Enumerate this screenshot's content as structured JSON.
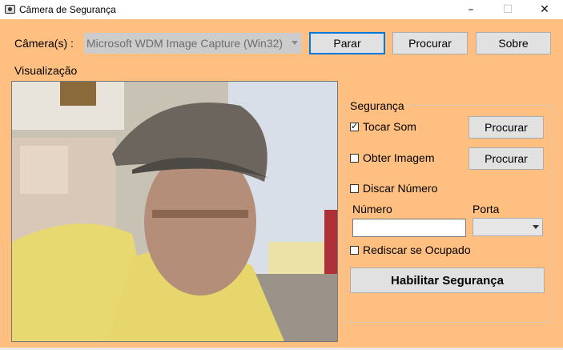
{
  "window": {
    "title": "Câmera de Segurança",
    "minimize_glyph": "–",
    "maximize_glyph": "☐",
    "close_glyph": "✕"
  },
  "camera": {
    "label": "Câmera(s) :",
    "selected": "Microsoft WDM Image Capture (Win32)"
  },
  "toolbar": {
    "stop_label": "Parar",
    "browse_label": "Procurar",
    "about_label": "Sobre"
  },
  "preview": {
    "label": "Visualização"
  },
  "security": {
    "group_label": "Segurança",
    "play_sound": {
      "label": "Tocar Som",
      "checked": true,
      "browse_label": "Procurar"
    },
    "get_image": {
      "label": "Obter Imagem",
      "checked": false,
      "browse_label": "Procurar"
    },
    "dial_number": {
      "label": "Discar Número",
      "checked": false
    },
    "number_label": "Número",
    "number_value": "",
    "port_label": "Porta",
    "port_value": "",
    "redial": {
      "label": "Rediscar se Ocupado",
      "checked": false
    },
    "enable_label": "Habilitar Segurança"
  },
  "colors": {
    "background": "#ffbf80",
    "button_face": "#e1e1e1",
    "focus_border": "#0078d7"
  },
  "icons": [
    "app-camera-icon",
    "minimize-icon",
    "maximize-icon",
    "close-icon",
    "chevron-down-icon",
    "checkbox-checked-icon"
  ]
}
